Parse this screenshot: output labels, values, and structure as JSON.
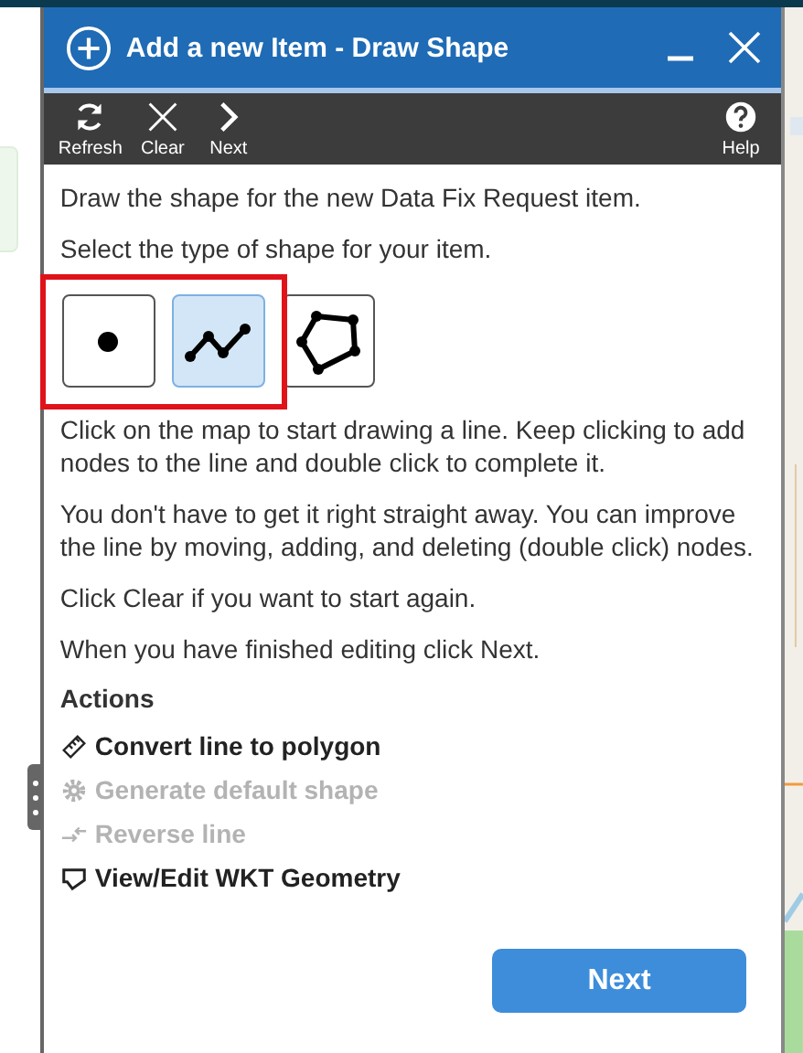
{
  "window": {
    "title": "Add a new Item - Draw Shape"
  },
  "toolbar": [
    {
      "kind": "refresh",
      "label": "Refresh"
    },
    {
      "kind": "clear",
      "label": "Clear"
    },
    {
      "kind": "next",
      "label": "Next"
    },
    {
      "kind": "help",
      "label": "Help"
    }
  ],
  "intro": "Draw the shape for the new Data Fix Request item.",
  "shape_prompt": "Select the type of shape for your item.",
  "shapes": [
    {
      "kind": "point",
      "selected": false
    },
    {
      "kind": "line",
      "selected": true
    },
    {
      "kind": "polygon",
      "selected": false
    }
  ],
  "paragraphs": [
    "Click on the map to start drawing a line. Keep clicking to add nodes to the line and double click to complete it.",
    "You don't have to get it right straight away. You can improve the line by moving, adding, and deleting (double click) nodes.",
    "Click Clear if you want to start again.",
    "When you have finished editing click Next."
  ],
  "actions_heading": "Actions",
  "actions": [
    {
      "kind": "convert",
      "label": "Convert line to polygon",
      "disabled": false
    },
    {
      "kind": "generate",
      "label": "Generate default shape",
      "disabled": true
    },
    {
      "kind": "reverse",
      "label": "Reverse line",
      "disabled": true
    },
    {
      "kind": "wkt",
      "label": "View/Edit WKT Geometry",
      "disabled": false
    }
  ],
  "next_button": "Next"
}
